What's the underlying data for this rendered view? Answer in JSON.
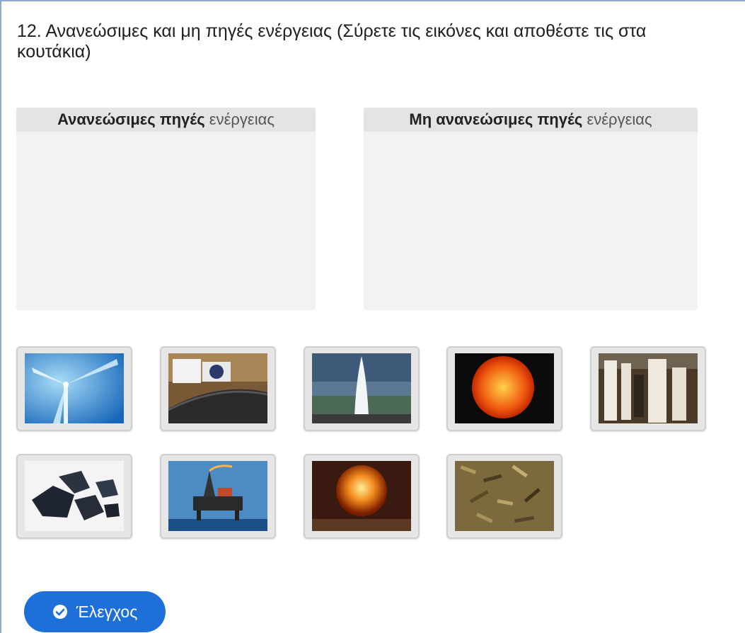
{
  "question": {
    "text": "12. Ανανεώσιμες και μη πηγές ενέργειας (Σύρετε τις εικόνες και αποθέστε τις στα κουτάκια)"
  },
  "buckets": [
    {
      "bold": "Ανανεώσιμες πηγές",
      "light": " ενέργειας"
    },
    {
      "bold": "Μη ανανεώσιμες πηγές",
      "light": " ενέργειας"
    }
  ],
  "tiles": [
    {
      "icon": "wind-turbine-image"
    },
    {
      "icon": "oil-pipeline-image"
    },
    {
      "icon": "geyser-image"
    },
    {
      "icon": "sun-image"
    },
    {
      "icon": "waterfall-image"
    },
    {
      "icon": "coal-image"
    },
    {
      "icon": "oil-platform-image"
    },
    {
      "icon": "nuclear-explosion-image"
    },
    {
      "icon": "biomass-wood-chips-image"
    }
  ],
  "check_button": {
    "label": "Έλεγχος",
    "icon": "check-circle-icon"
  },
  "colors": {
    "accent": "#1f6fd9",
    "bucket_bg": "#f2f2f2",
    "bucket_header": "#e4e4e4"
  }
}
